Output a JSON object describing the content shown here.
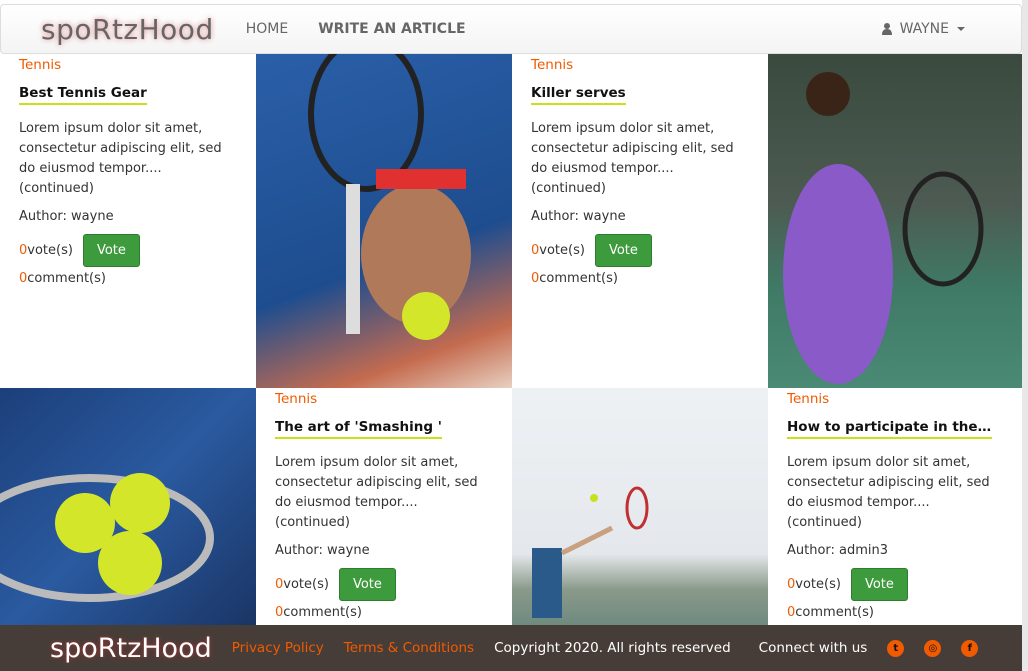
{
  "nav": {
    "logo": "spoRtzHood",
    "home": "HOME",
    "write": "WRITE AN ARTICLE",
    "user": "WAYNE"
  },
  "articles": [
    {
      "category": "Tennis",
      "title": "Best Tennis Gear",
      "excerpt": "Lorem ipsum dolor sit amet, consectetur adipiscing elit, sed do eiusmod tempor.... (continued)",
      "author": "Author: wayne",
      "votes": "0",
      "votes_label": "vote(s)",
      "vote_button": "Vote",
      "comments": "0",
      "comments_label": "comment(s)"
    },
    {
      "category": "Tennis",
      "title": "Killer serves",
      "excerpt": "Lorem ipsum dolor sit amet, consectetur adipiscing elit, sed do eiusmod tempor.... (continued)",
      "author": "Author: wayne",
      "votes": "0",
      "votes_label": "vote(s)",
      "vote_button": "Vote",
      "comments": "0",
      "comments_label": "comment(s)"
    },
    {
      "category": "Tennis",
      "title": "The art of 'Smashing '",
      "excerpt": "Lorem ipsum dolor sit amet, consectetur adipiscing elit, sed do eiusmod tempor.... (continued)",
      "author": "Author: wayne",
      "votes": "0",
      "votes_label": "vote(s)",
      "vote_button": "Vote",
      "comments": "0",
      "comments_label": "comment(s)"
    },
    {
      "category": "Tennis",
      "title": "How to participate in the US Open",
      "excerpt": "Lorem ipsum dolor sit amet, consectetur adipiscing elit, sed do eiusmod tempor.... (continued)",
      "author": "Author: admin3",
      "votes": "0",
      "votes_label": "vote(s)",
      "vote_button": "Vote",
      "comments": "0",
      "comments_label": "comment(s)"
    }
  ],
  "footer": {
    "logo": "spoRtzHood",
    "privacy": "Privacy Policy",
    "terms": "Terms & Conditions",
    "copyright": "Copyright 2020. All rights reserved",
    "connect": "Connect with us"
  }
}
